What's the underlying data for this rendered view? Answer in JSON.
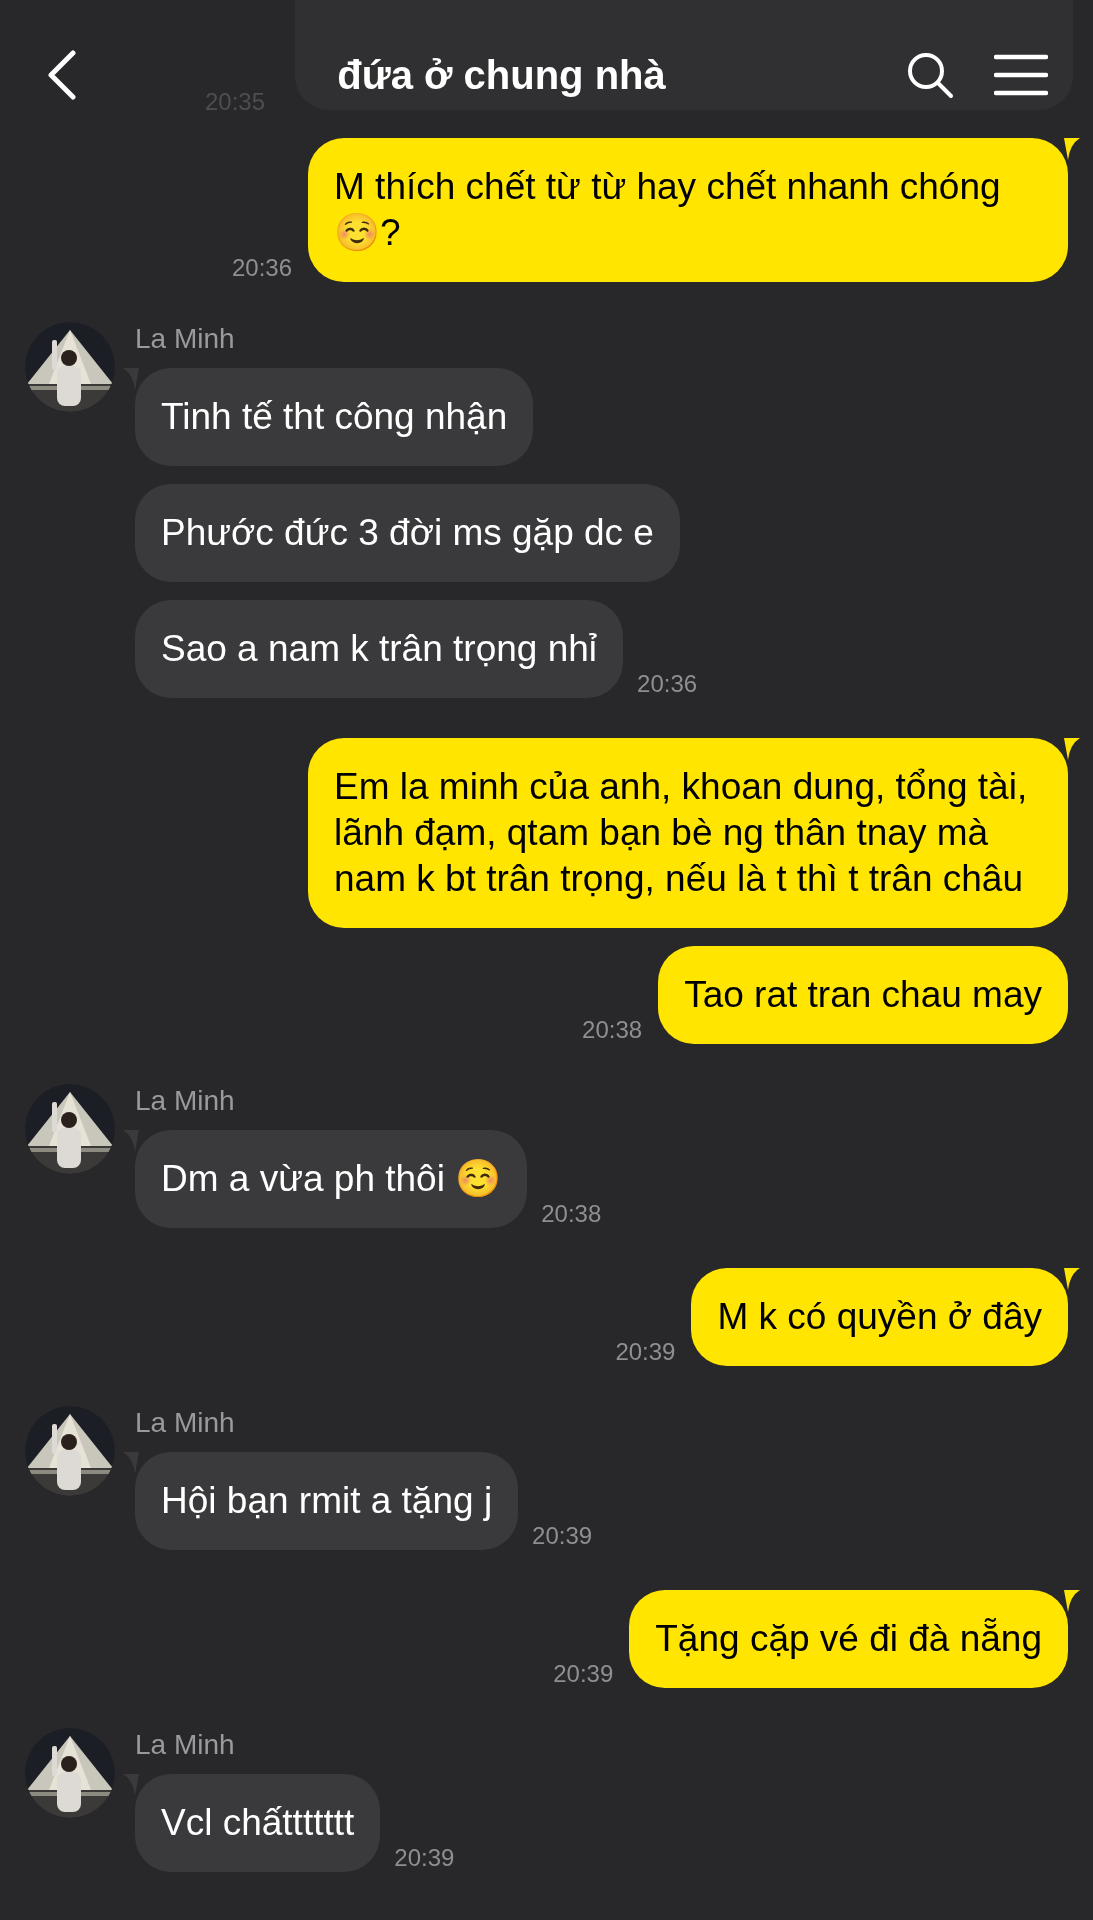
{
  "header": {
    "title": "đứa ở chung nhà",
    "faded_time": "20:35"
  },
  "groups": [
    {
      "kind": "me",
      "messages": [
        "M thích chết từ từ hay chết nhanh chóng ☺️?"
      ],
      "time": "20:36"
    },
    {
      "kind": "other",
      "name": "La Minh",
      "messages": [
        "Tinh tế tht công nhận",
        "Phước đức 3 đời ms gặp dc e",
        "Sao a nam k trân trọng nhỉ"
      ],
      "time": "20:36"
    },
    {
      "kind": "me",
      "messages": [
        "Em la minh của anh, khoan dung, tổng tài, lãnh đạm, qtam bạn bè ng thân tnay mà nam k bt trân trọng, nếu là t thì t trân châu",
        "Tao rat tran chau may"
      ],
      "time": "20:38"
    },
    {
      "kind": "other",
      "name": "La Minh",
      "messages": [
        "Dm a vừa ph thôi ☺️"
      ],
      "time": "20:38"
    },
    {
      "kind": "me",
      "messages": [
        "M k có quyền ở đây"
      ],
      "time": "20:39"
    },
    {
      "kind": "other",
      "name": "La Minh",
      "messages": [
        "Hội bạn rmit a tặng j"
      ],
      "time": "20:39"
    },
    {
      "kind": "me",
      "messages": [
        "Tặng cặp vé đi đà nẵng"
      ],
      "time": "20:39"
    },
    {
      "kind": "other",
      "name": "La Minh",
      "messages": [
        "Vcl chấttttttt"
      ],
      "time": "20:39"
    }
  ]
}
